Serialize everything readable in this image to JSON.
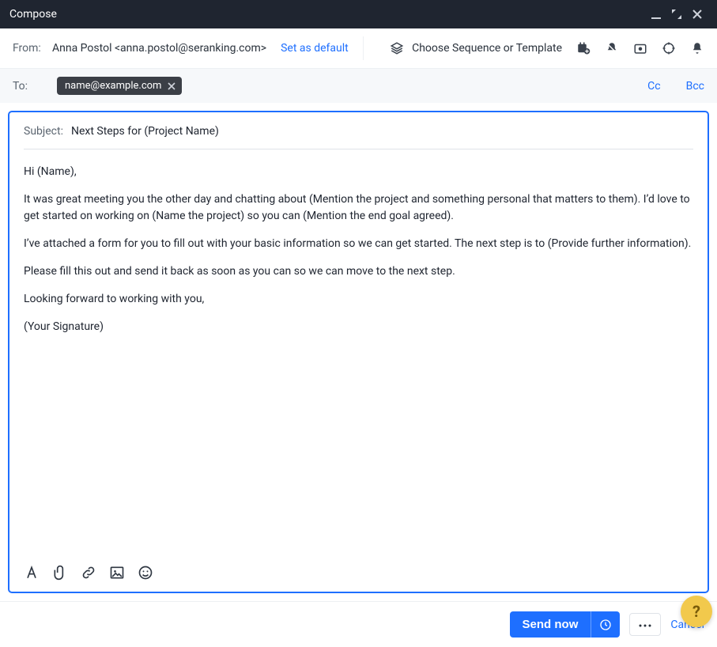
{
  "titlebar": {
    "title": "Compose"
  },
  "from": {
    "label": "From:",
    "sender": "Anna Postol <anna.postol@seranking.com>",
    "set_default": "Set as default",
    "sequence_label": "Choose Sequence or Template"
  },
  "to": {
    "label": "To:",
    "chips": [
      "name@example.com"
    ],
    "cc": "Cc",
    "bcc": "Bcc"
  },
  "subject": {
    "label": "Subject:",
    "value": "Next Steps for (Project Name)"
  },
  "body": {
    "p1": "Hi (Name),",
    "p2": "It was great meeting you the other day and chatting about (Mention the project and something personal that matters to them). I’d love to get started on working on (Name the project) so you can (Mention the end goal agreed).",
    "p3": "I’ve attached a form for you to fill out with your basic information so we can get started. The next step is to (Provide further information).",
    "p4": "Please fill this out and send it back as soon as you can so we can move to the next step.",
    "p5": "Looking forward to working with you,",
    "p6": "(Your Signature)"
  },
  "footer": {
    "send": "Send now",
    "cancel": "Cancel"
  },
  "help": {
    "label": "?"
  }
}
